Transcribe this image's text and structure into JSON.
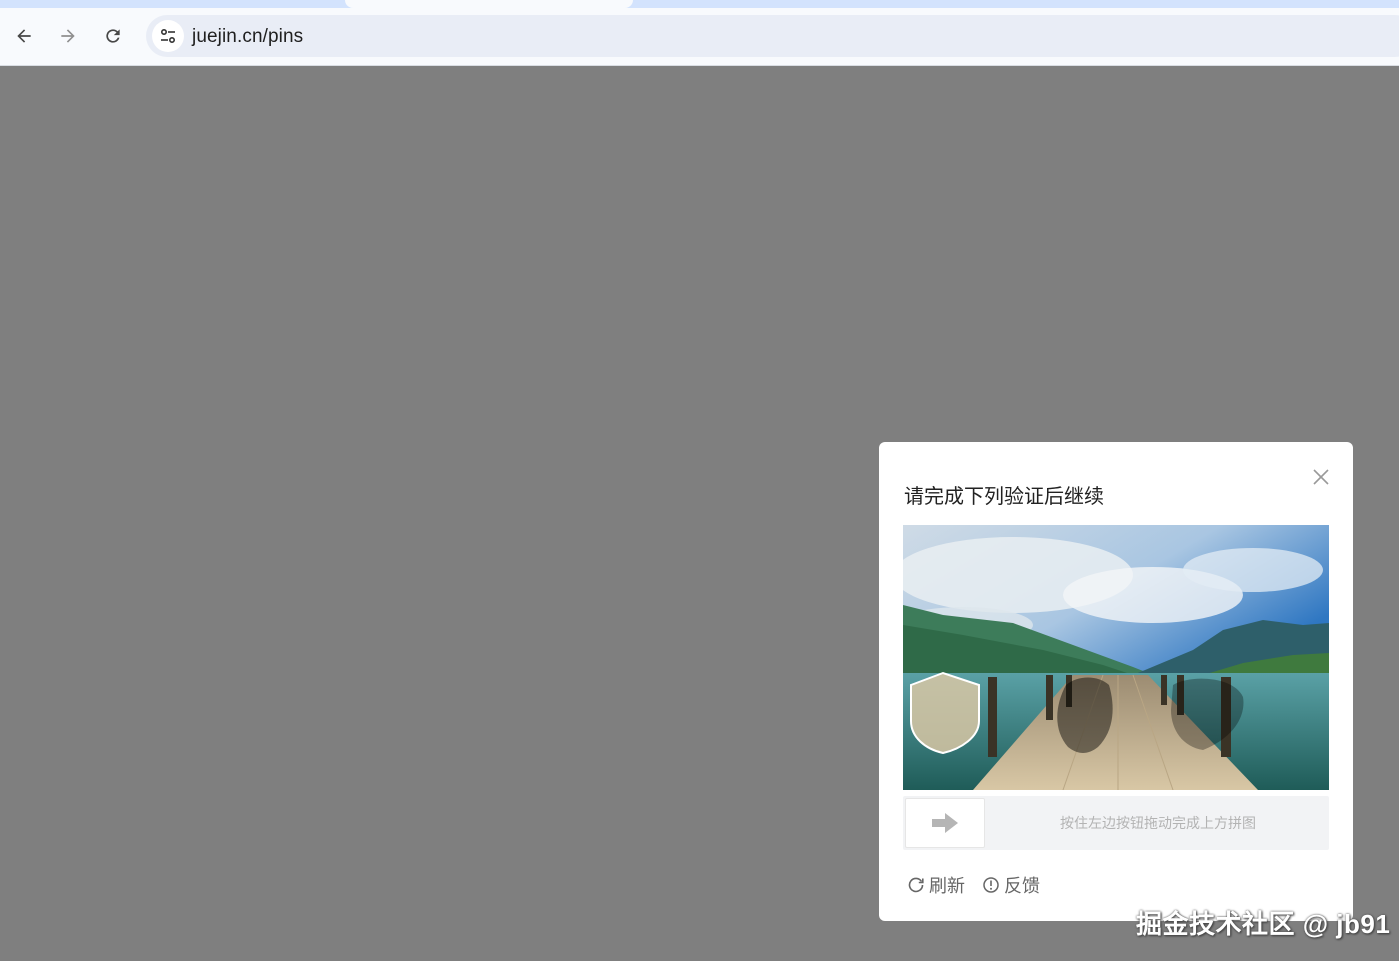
{
  "browser": {
    "url": "juejin.cn/pins"
  },
  "dialog": {
    "title": "请完成下列验证后继续",
    "slider_hint": "按住左边按钮拖动完成上方拼图",
    "refresh_label": "刷新",
    "feedback_label": "反馈"
  },
  "watermark": {
    "text": "掘金技术社区 @ jb91"
  },
  "colors": {
    "overlay": "#7f7f7f",
    "dialog_bg": "#ffffff",
    "slider_track": "#f2f3f5",
    "text_muted": "#b3b3b3"
  },
  "icons": {
    "back": "arrow-left-icon",
    "forward": "arrow-right-icon",
    "reload": "reload-icon",
    "site_info": "tune-icon",
    "close": "close-icon",
    "slider": "arrow-right-solid-icon",
    "refresh": "refresh-icon",
    "feedback": "exclamation-circle-icon"
  }
}
